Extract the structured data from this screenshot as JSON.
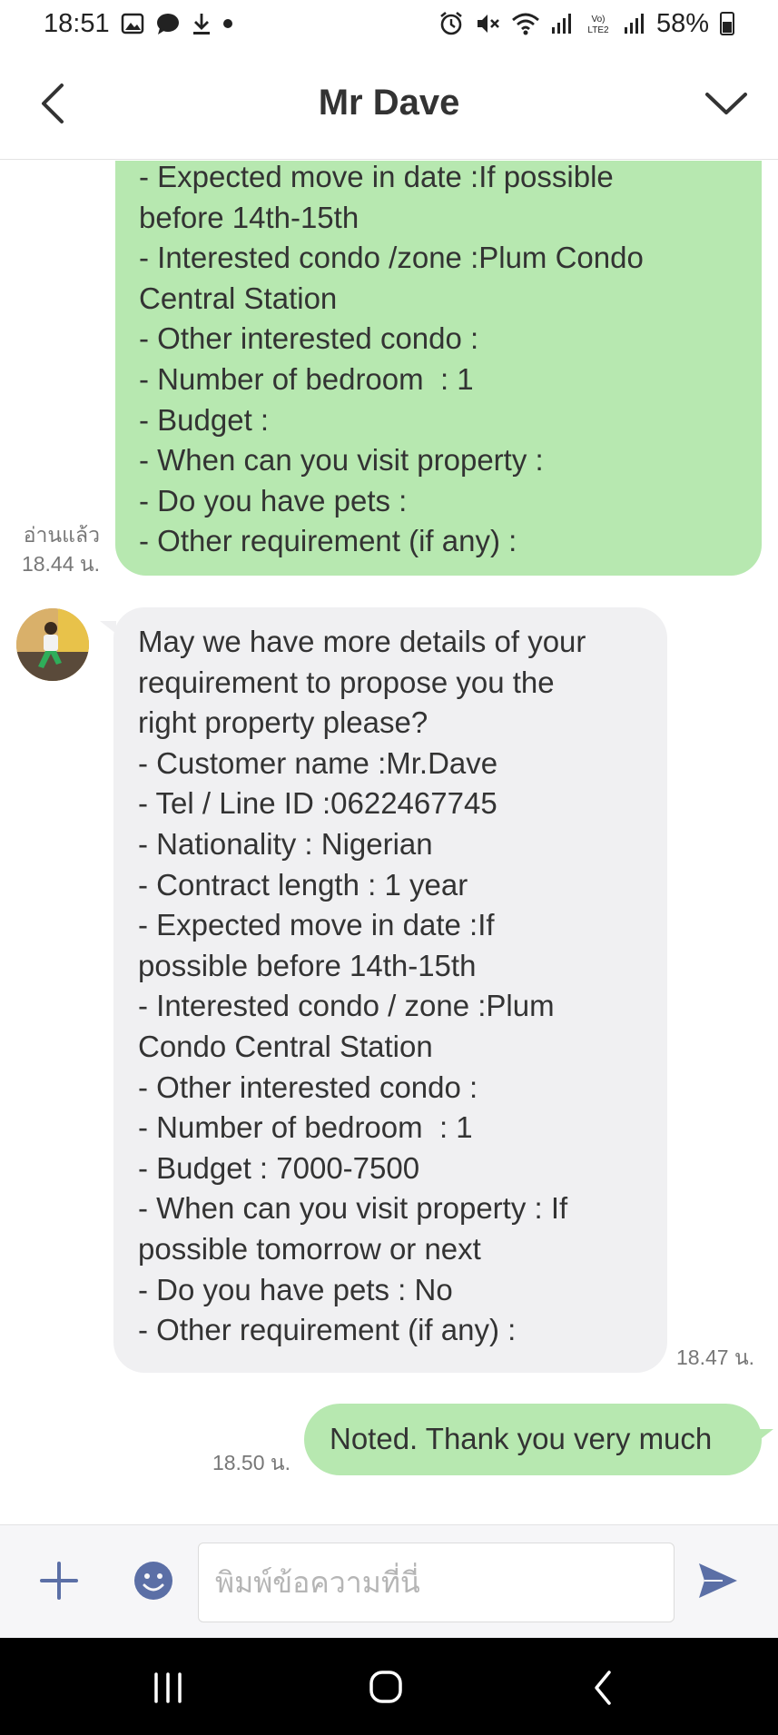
{
  "status_bar": {
    "time": "18:51",
    "battery_percent": "58%",
    "icons_left": [
      "image-icon",
      "chat-icon",
      "download-icon",
      "dot-icon"
    ],
    "icons_right": [
      "alarm-icon",
      "mute-icon",
      "wifi-icon",
      "signal-icon",
      "volte-icon",
      "signal-icon",
      "battery-icon"
    ]
  },
  "header": {
    "title": "Mr Dave"
  },
  "messages": [
    {
      "sender": "me",
      "text": "- Expected move in date :If possible\nbefore 14th-15th\n- Interested condo /zone :Plum Condo\nCentral Station\n- Other interested condo :\n- Number of bedroom  : 1\n- Budget :\n- When can you visit property :\n- Do you have pets :\n- Other requirement (if any) :",
      "read_label": "อ่านแล้ว",
      "time": "18.44 น."
    },
    {
      "sender": "them",
      "text": "May we have more details of your\nrequirement to propose you the\nright property please?\n- Customer name :Mr.Dave\n- Tel / Line ID :0622467745\n- Nationality : Nigerian\n- Contract length : 1 year\n- Expected move in date :If\npossible before 14th-15th\n- Interested condo / zone :Plum\nCondo Central Station\n- Other interested condo :\n- Number of bedroom  : 1\n- Budget : 7000-7500\n- When can you visit property : If\npossible tomorrow or next\n- Do you have pets : No\n- Other requirement (if any) :",
      "time": "18.47 น."
    },
    {
      "sender": "me",
      "text": "Noted. Thank you very much",
      "time": "18.50 น."
    }
  ],
  "input_bar": {
    "placeholder": "พิมพ์ข้อความที่นี่"
  },
  "colors": {
    "outgoing_bubble": "#b7e8b0",
    "incoming_bubble": "#f0f0f2",
    "accent": "#5b6fa6"
  }
}
